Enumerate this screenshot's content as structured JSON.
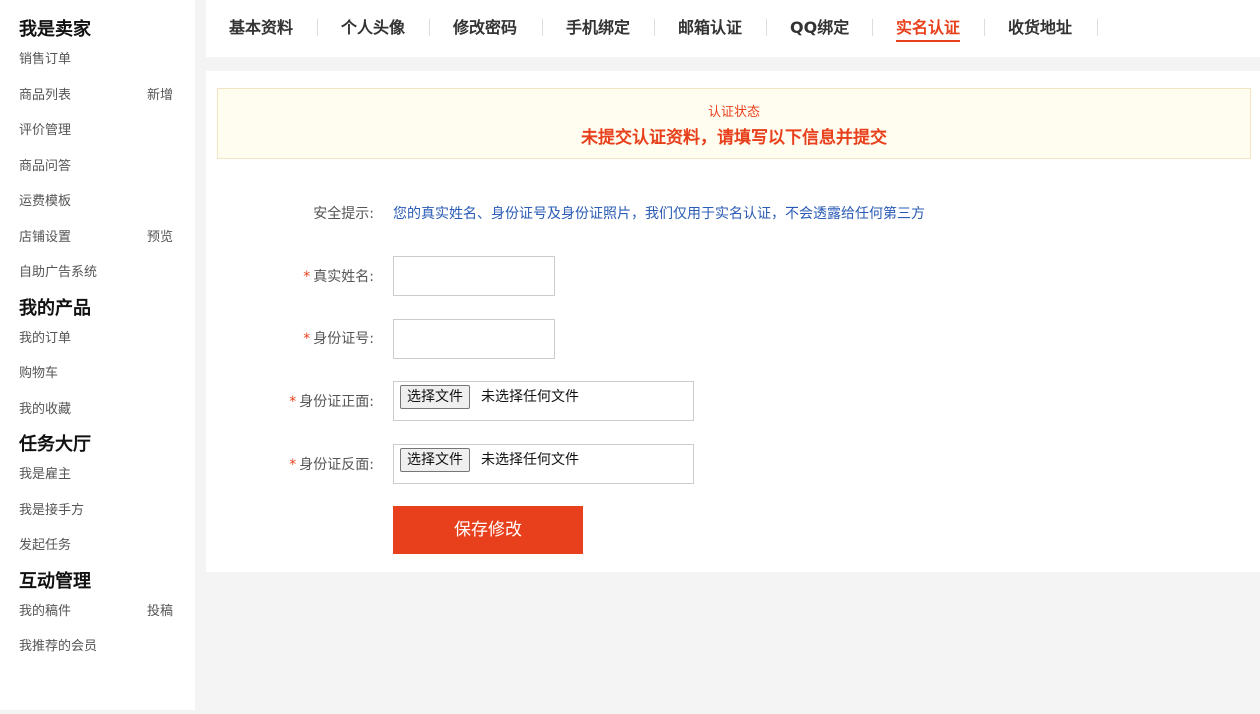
{
  "sidebar": {
    "groups": [
      {
        "title": "我是卖家",
        "items": [
          {
            "label": "销售订单"
          },
          {
            "label": "商品列表",
            "extra": "新增"
          },
          {
            "label": "评价管理"
          },
          {
            "label": "商品问答"
          },
          {
            "label": "运费模板"
          },
          {
            "label": "店铺设置",
            "extra": "预览"
          },
          {
            "label": "自助广告系统"
          }
        ]
      },
      {
        "title": "我的产品",
        "items": [
          {
            "label": "我的订单"
          },
          {
            "label": "购物车"
          },
          {
            "label": "我的收藏"
          }
        ]
      },
      {
        "title": "任务大厅",
        "items": [
          {
            "label": "我是雇主"
          },
          {
            "label": "我是接手方"
          },
          {
            "label": "发起任务"
          }
        ]
      },
      {
        "title": "互动管理",
        "items": [
          {
            "label": "我的稿件",
            "extra": "投稿"
          },
          {
            "label": "我推荐的会员"
          }
        ]
      }
    ]
  },
  "tabs": [
    {
      "label": "基本资料",
      "active": false
    },
    {
      "label": "个人头像",
      "active": false
    },
    {
      "label": "修改密码",
      "active": false
    },
    {
      "label": "手机绑定",
      "active": false
    },
    {
      "label": "邮箱认证",
      "active": false
    },
    {
      "label": "QQ绑定",
      "active": false
    },
    {
      "label": "实名认证",
      "active": true
    },
    {
      "label": "收货地址",
      "active": false
    }
  ],
  "status": {
    "label": "认证状态",
    "text": "未提交认证资料，请填写以下信息并提交"
  },
  "form": {
    "tip_label": "安全提示:",
    "tip_text": "您的真实姓名、身份证号及身份证照片，我们仅用于实名认证，不会透露给任何第三方",
    "required_mark": "*",
    "name_label": "真实姓名:",
    "name_value": "",
    "id_label": "身份证号:",
    "id_value": "",
    "front_label": "身份证正面:",
    "back_label": "身份证反面:",
    "file_button": "选择文件",
    "file_status": "未选择任何文件",
    "save_button": "保存修改"
  },
  "colors": {
    "accent": "#e8401c",
    "tip_blue": "#2a5bb5",
    "notice_bg": "#fffdf0"
  }
}
